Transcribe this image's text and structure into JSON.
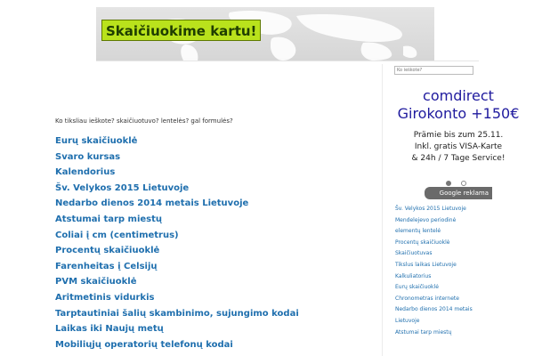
{
  "header": {
    "title": "Skaičiuokime kartu!"
  },
  "main": {
    "question": "Ko tiksliau ieškote? skaičiuotuvo? lentelės? gal formulės?",
    "links": [
      "Eurų skaičiuoklė",
      "Svaro kursas",
      "Kalendorius",
      "Šv. Velykos 2015 Lietuvoje",
      "Nedarbo dienos 2014 metais Lietuvoje",
      "Atstumai tarp miestų",
      "Coliai į cm (centimetrus)",
      "Procentų skaičiuoklė",
      "Farenheitas į Celsijų",
      "PVM skaičiuoklė",
      "Aritmetinis vidurkis",
      "Tarptautiniai šalių skambinimo, sujungimo kodai",
      "Laikas iki Naujų metų",
      "Mobiliųjų operatorių telefonų kodai"
    ]
  },
  "sidebar": {
    "search_placeholder": "Ko ieškote?",
    "ad": {
      "title_line1": "comdirect",
      "title_line2": "Girokonto +150€",
      "body_line1": "Prämie bis zum 25.11.",
      "body_line2": "Inkl. gratis VISA-Karte",
      "body_line3": "& 24h / 7 Tage Service!",
      "footer_label": "Google reklama"
    },
    "links": [
      "Šv. Velykos 2015 Lietuvoje",
      "Mendelejevo periodinė",
      "elementų lentelė",
      "Procentų skaičiuoklė",
      "Skaičiuotuvas",
      "Tikslus laikas Lietuvoje",
      "Kalkuliatorius",
      "Eurų skaičiuoklė",
      "Chronometras internete",
      "Nedarbo dienos 2014 metais",
      "Lietuvoje",
      "Atstumai tarp miestų"
    ]
  },
  "colors": {
    "link": "#1f6fae",
    "ad_title": "#1f1a9e",
    "banner_accent": "#b9e21c"
  }
}
